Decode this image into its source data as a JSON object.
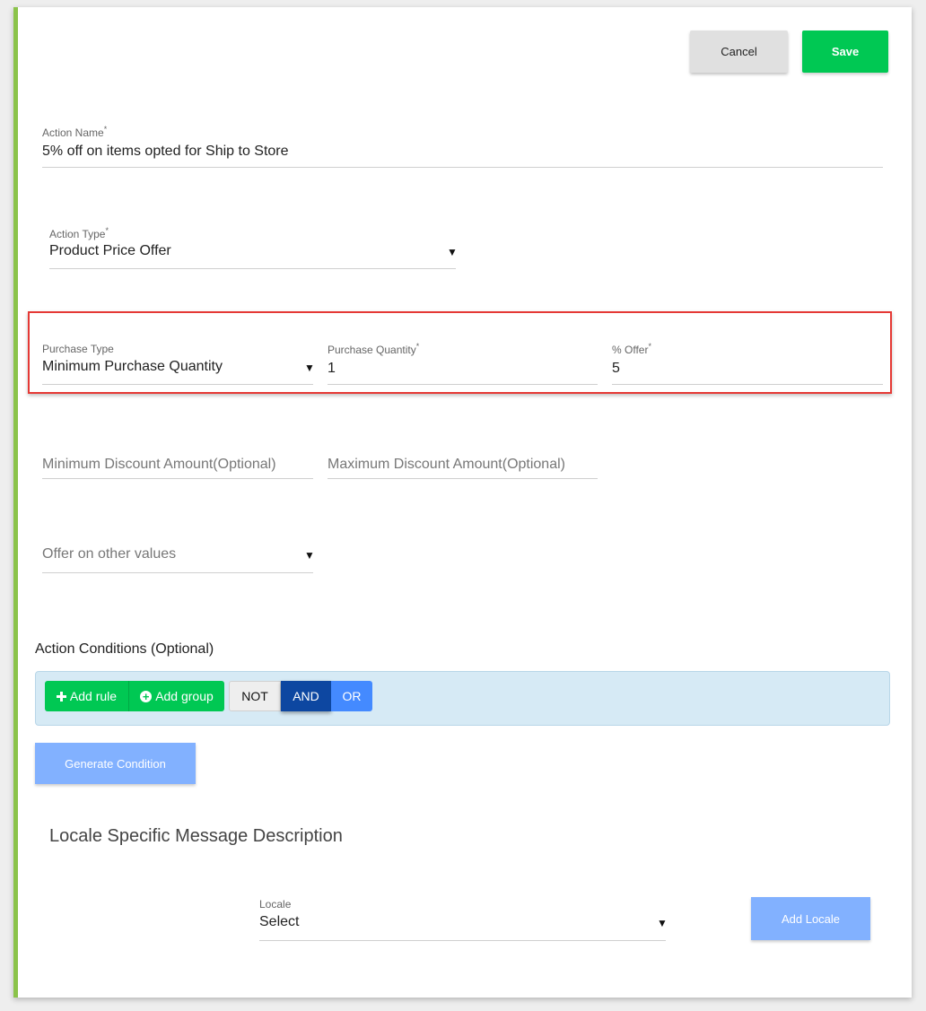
{
  "toolbar": {
    "cancel_label": "Cancel",
    "save_label": "Save"
  },
  "action_name": {
    "label": "Action Name",
    "required": "*",
    "value": "5% off on items opted for Ship to Store"
  },
  "action_type": {
    "label": "Action Type",
    "required": "*",
    "value": "Product Price Offer"
  },
  "purchase_type": {
    "label": "Purchase Type",
    "value": "Minimum Purchase Quantity"
  },
  "purchase_quantity": {
    "label": "Purchase Quantity",
    "required": "*",
    "value": "1"
  },
  "offer_percent": {
    "label": "% Offer",
    "required": "*",
    "value": "5"
  },
  "min_discount": {
    "placeholder": "Minimum Discount Amount(Optional)"
  },
  "max_discount": {
    "placeholder": "Maximum Discount Amount(Optional)"
  },
  "offer_other": {
    "placeholder": "Offer on other values"
  },
  "conditions": {
    "heading": "Action Conditions (Optional)",
    "add_rule": "Add rule",
    "add_group": "Add group",
    "not_label": "NOT",
    "and_label": "AND",
    "or_label": "OR",
    "generate_label": "Generate Condition"
  },
  "locale_section": {
    "heading": "Locale Specific Message Description",
    "locale_label": "Locale",
    "locale_value": "Select",
    "add_locale_label": "Add Locale"
  },
  "colors": {
    "accent_bar": "#8bc34a",
    "save": "#00c853",
    "and_active": "#0d47a1",
    "or": "#448aff",
    "disabled_btn": "#82b1ff",
    "highlight": "#e53935"
  },
  "icons": {
    "caret": "caret-down-icon",
    "plus": "plus-icon",
    "plus_circle": "plus-circle-icon"
  }
}
